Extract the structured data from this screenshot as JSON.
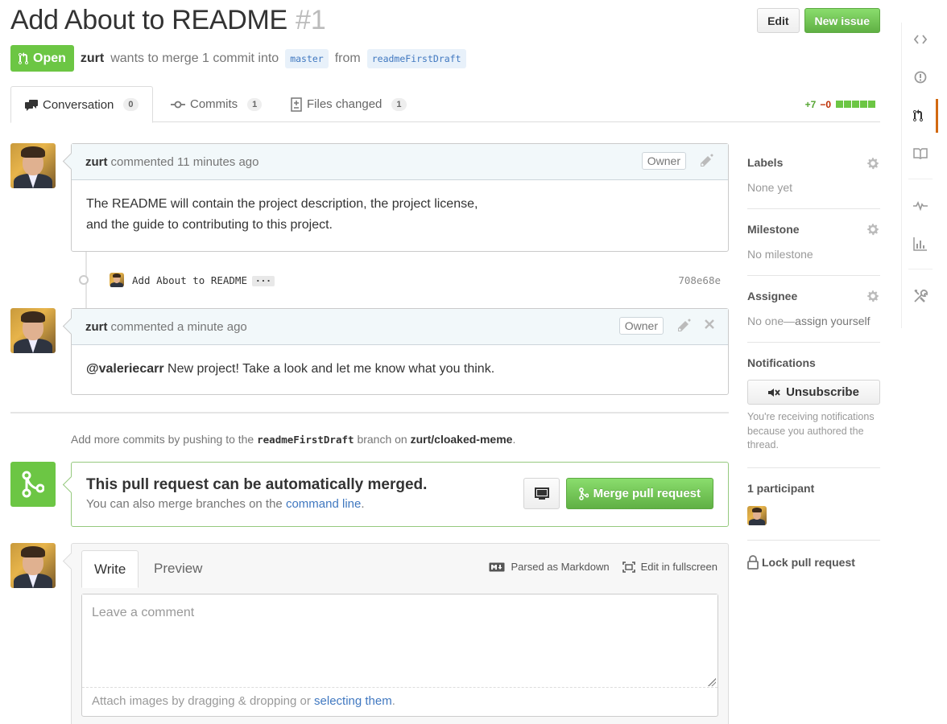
{
  "header": {
    "title": "Add About to README",
    "number": "#1",
    "edit_label": "Edit",
    "new_issue_label": "New issue"
  },
  "meta": {
    "state": "Open",
    "author": "zurt",
    "text_merge": "wants to merge 1 commit into",
    "base_branch": "master",
    "text_from": "from",
    "head_branch": "readmeFirstDraft"
  },
  "tabs": [
    {
      "label": "Conversation",
      "count": "0"
    },
    {
      "label": "Commits",
      "count": "1"
    },
    {
      "label": "Files changed",
      "count": "1"
    }
  ],
  "diffstat": {
    "additions": "+7",
    "deletions": "−0"
  },
  "comments": [
    {
      "author": "zurt",
      "action": "commented 11 minutes ago",
      "badge": "Owner",
      "body_line1": "The README will contain the project description, the project license,",
      "body_line2": "and the guide to contributing to this project."
    },
    {
      "author": "zurt",
      "action": "commented a minute ago",
      "badge": "Owner",
      "mention": "@valeriecarr",
      "body": " New project! Take a look and let me know what you think."
    }
  ],
  "commit": {
    "message": "Add About to README",
    "ellipsis": "···",
    "sha": "708e68e"
  },
  "push_note": {
    "prefix": "Add more commits by pushing to the",
    "branch": "readmeFirstDraft",
    "middle": "branch on",
    "repo": "zurt/cloaked-meme",
    "suffix": "."
  },
  "merge": {
    "title": "This pull request can be automatically merged.",
    "sub_prefix": "You can also merge branches on the",
    "sub_link": "command line",
    "sub_suffix": ".",
    "button": "Merge pull request"
  },
  "editor": {
    "write_tab": "Write",
    "preview_tab": "Preview",
    "markdown_label": "Parsed as Markdown",
    "fullscreen_label": "Edit in fullscreen",
    "placeholder": "Leave a comment",
    "attach_prefix": "Attach images by dragging & dropping or",
    "attach_link": "selecting them",
    "attach_suffix": "."
  },
  "sidebar": {
    "labels_title": "Labels",
    "labels_value": "None yet",
    "milestone_title": "Milestone",
    "milestone_value": "No milestone",
    "assignee_title": "Assignee",
    "assignee_value": "No one—",
    "assignee_link": "assign yourself",
    "notifications_title": "Notifications",
    "unsubscribe_label": "Unsubscribe",
    "notifications_note": "You're receiving notifications because you authored the thread.",
    "participants_title": "1 participant",
    "lock_label": "Lock pull request"
  },
  "colors": {
    "green": "#6cc644",
    "link": "#4078c0",
    "rail_active": "#d26911"
  }
}
